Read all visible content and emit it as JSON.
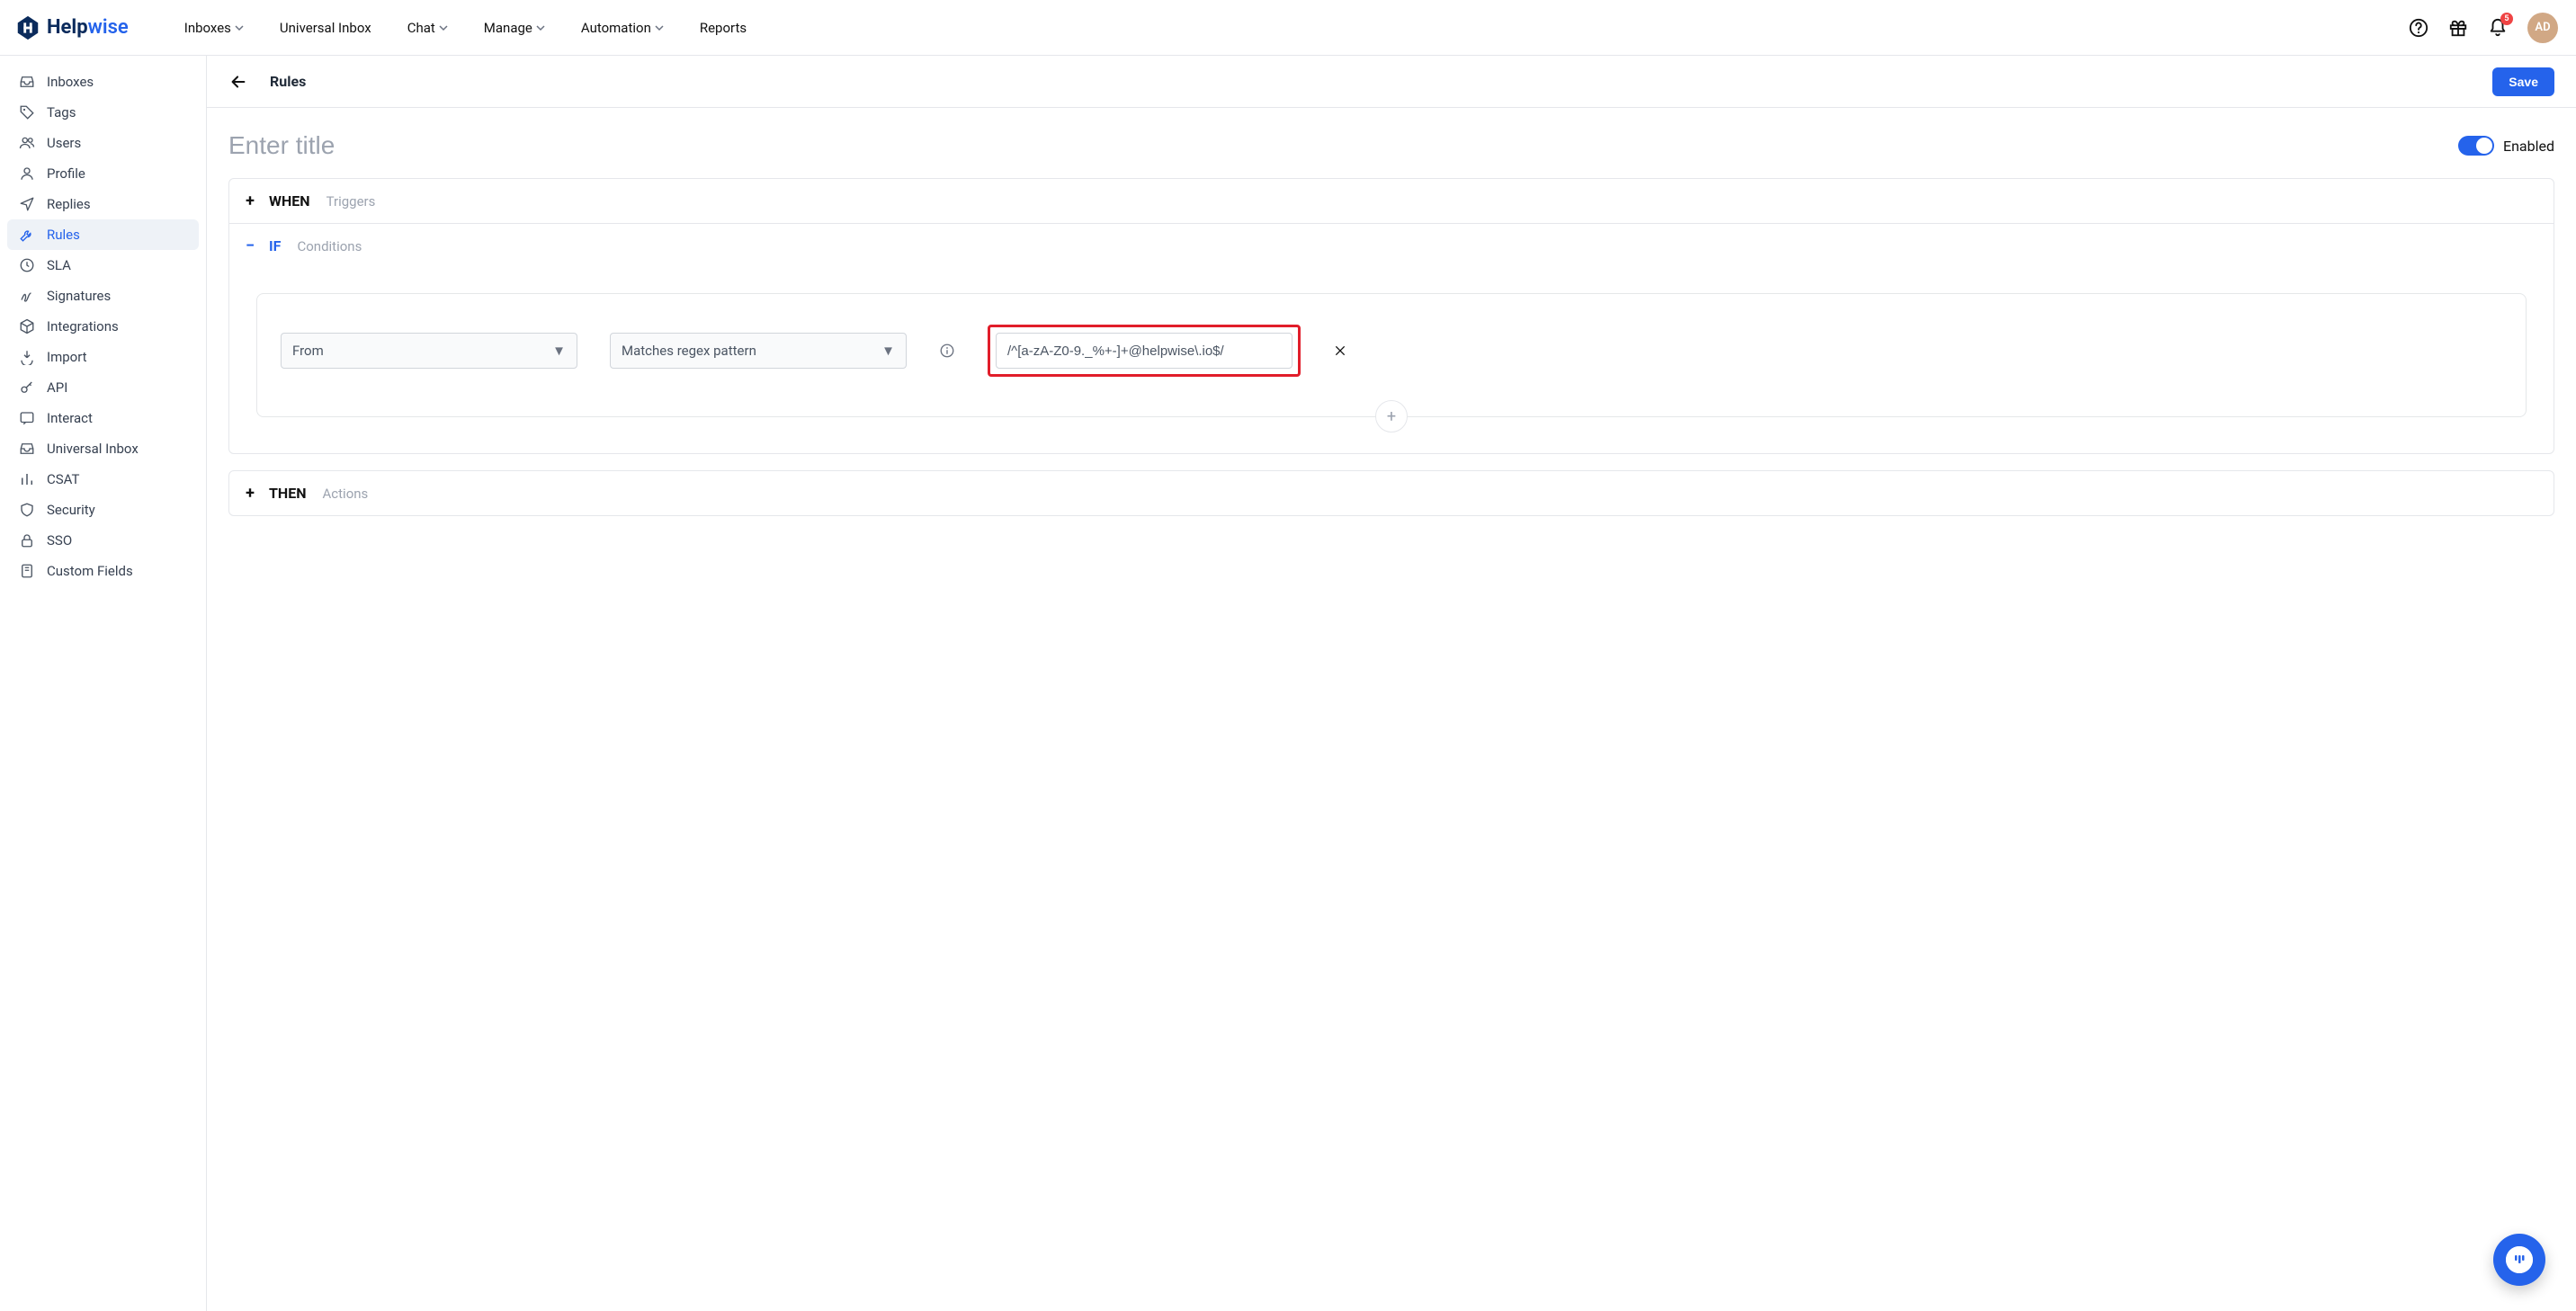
{
  "brand": {
    "part1": "Help",
    "part2": "wise"
  },
  "nav": {
    "inboxes": "Inboxes",
    "universal": "Universal Inbox",
    "chat": "Chat",
    "manage": "Manage",
    "automation": "Automation",
    "reports": "Reports"
  },
  "notif_count": "5",
  "avatar_initials": "AD",
  "sidebar": {
    "items": [
      {
        "label": "Inboxes",
        "icon": "inbox-icon"
      },
      {
        "label": "Tags",
        "icon": "tag-icon"
      },
      {
        "label": "Users",
        "icon": "users-icon"
      },
      {
        "label": "Profile",
        "icon": "profile-icon"
      },
      {
        "label": "Replies",
        "icon": "send-icon"
      },
      {
        "label": "Rules",
        "icon": "wrench-icon",
        "active": true
      },
      {
        "label": "SLA",
        "icon": "clock-icon"
      },
      {
        "label": "Signatures",
        "icon": "signature-icon"
      },
      {
        "label": "Integrations",
        "icon": "package-icon"
      },
      {
        "label": "Import",
        "icon": "import-icon"
      },
      {
        "label": "API",
        "icon": "key-icon"
      },
      {
        "label": "Interact",
        "icon": "chat-icon"
      },
      {
        "label": "Universal Inbox",
        "icon": "inbox-icon"
      },
      {
        "label": "CSAT",
        "icon": "bar-chart-icon"
      },
      {
        "label": "Security",
        "icon": "shield-icon"
      },
      {
        "label": "SSO",
        "icon": "lock-icon"
      },
      {
        "label": "Custom Fields",
        "icon": "book-icon"
      }
    ]
  },
  "subheader": {
    "title": "Rules",
    "save": "Save"
  },
  "rule": {
    "title_placeholder": "Enter title",
    "title_value": "",
    "enabled_label": "Enabled",
    "enabled": true,
    "sections": {
      "when": {
        "name": "WHEN",
        "sub": "Triggers",
        "expanded": false
      },
      "if": {
        "name": "IF",
        "sub": "Conditions",
        "expanded": true
      },
      "then": {
        "name": "THEN",
        "sub": "Actions",
        "expanded": false
      }
    },
    "condition": {
      "field": "From",
      "operator": "Matches regex pattern",
      "value": "/^[a-zA-Z0-9._%+-]+@helpwise\\.io$/"
    }
  }
}
